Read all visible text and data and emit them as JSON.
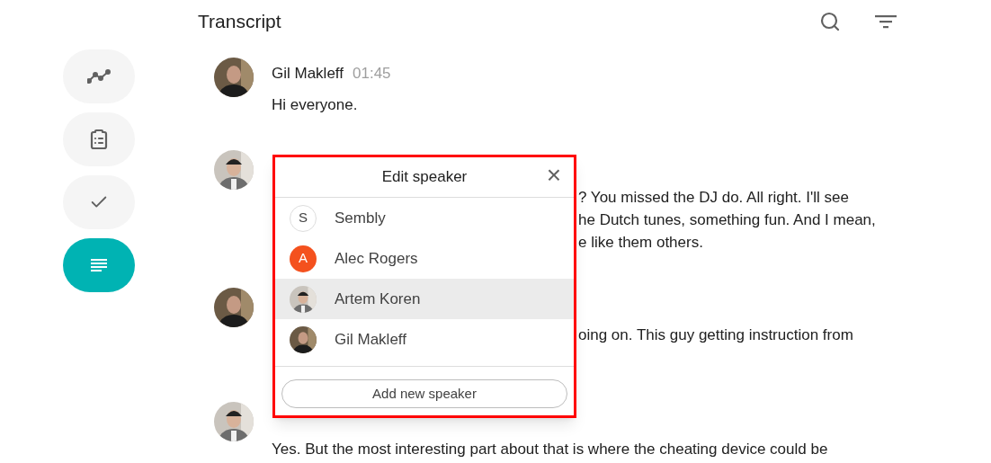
{
  "header": {
    "title": "Transcript"
  },
  "sidebar": {
    "items": [
      {
        "kind": "trend",
        "selected": false
      },
      {
        "kind": "clipboard",
        "selected": false
      },
      {
        "kind": "check",
        "selected": false
      },
      {
        "kind": "notes",
        "selected": true
      }
    ]
  },
  "messages": [
    {
      "speaker": "Gil Makleff",
      "time": "01:45",
      "lines": [
        "Hi everyone."
      ],
      "kind": "full"
    },
    {
      "lines": [
        "? You missed the DJ do. All right. I'll see",
        "he Dutch tunes, something fun. And I mean,",
        "e like them others."
      ],
      "kind": "partial"
    },
    {
      "lines": [
        "oing on. This guy getting instruction from"
      ],
      "kind": "partial"
    },
    {
      "lines": [
        "Yes. But the most interesting part about that is where the cheating device could be"
      ],
      "kind": "full"
    }
  ],
  "dialog": {
    "title": "Edit speaker",
    "close": "×",
    "speakers": [
      {
        "kind": "initial",
        "initial": "S",
        "name": "Sembly",
        "selected": false
      },
      {
        "kind": "initial",
        "initial": "A",
        "color": "#f4511e",
        "name": "Alec Rogers",
        "selected": false
      },
      {
        "name": "Artem Koren",
        "selected": true
      },
      {
        "name": "Gil Makleff",
        "selected": false
      }
    ],
    "add_button": "Add new speaker"
  }
}
